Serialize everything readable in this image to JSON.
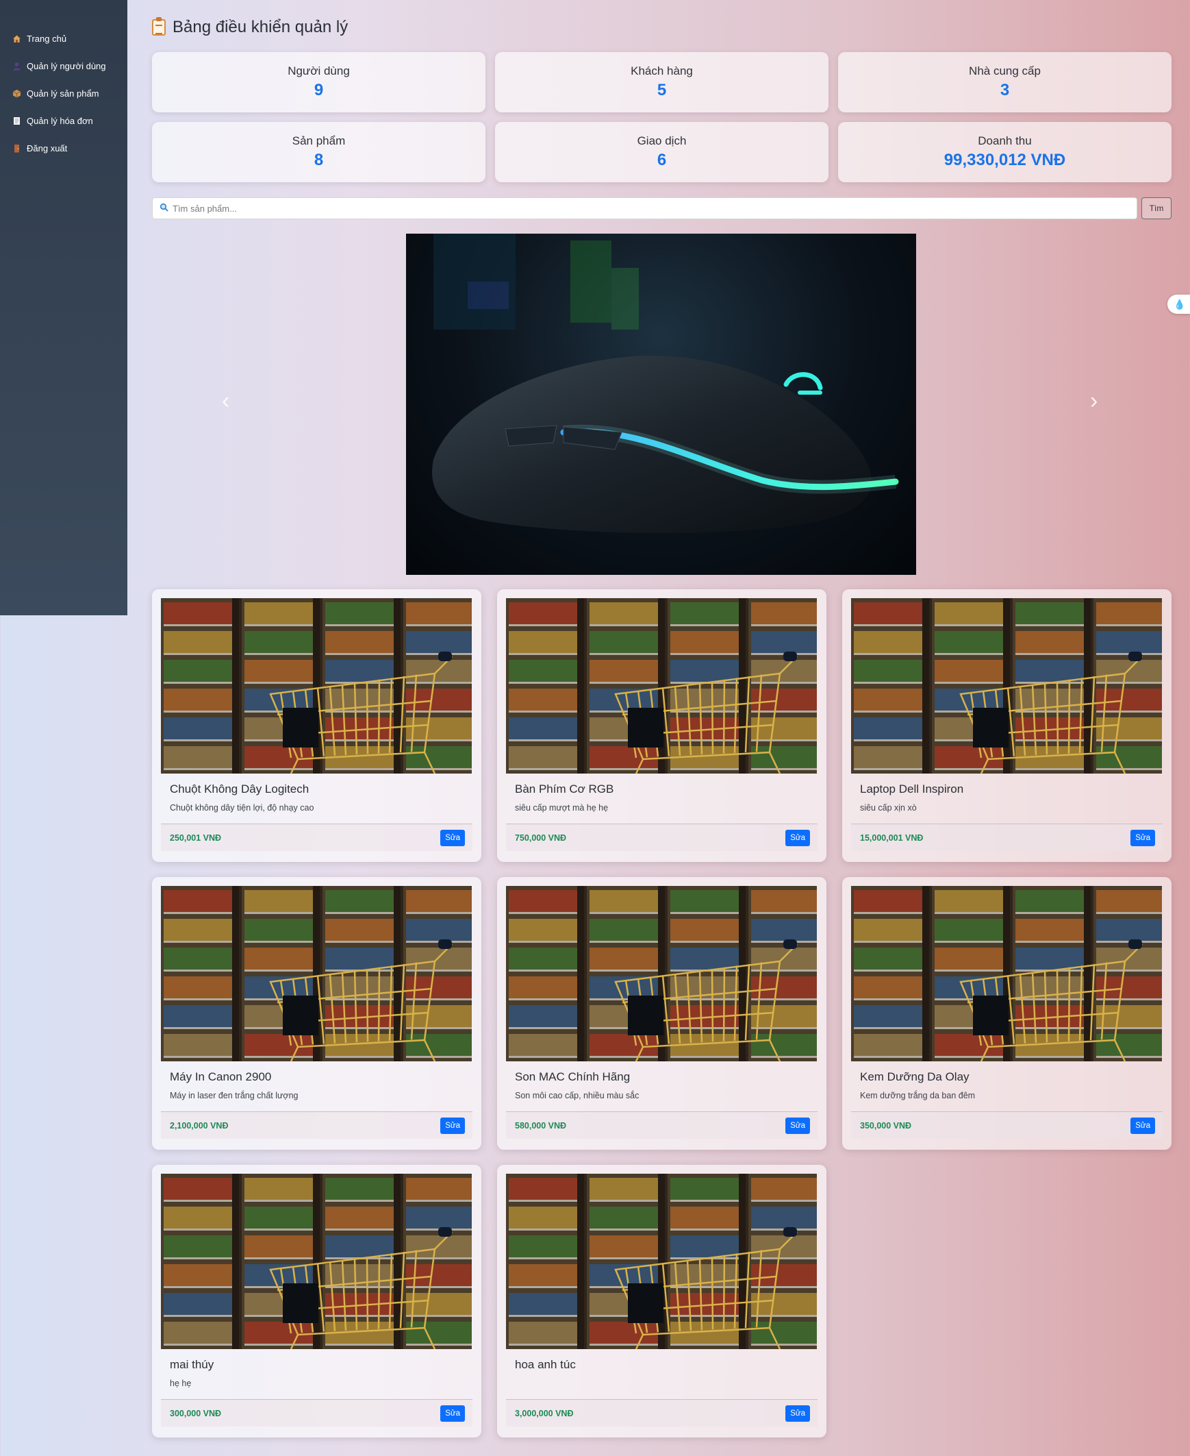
{
  "sidebar": {
    "items": [
      {
        "label": "Trang chủ",
        "icon": "house-icon"
      },
      {
        "label": "Quản lý người dùng",
        "icon": "user-icon"
      },
      {
        "label": "Quản lý sản phẩm",
        "icon": "box-icon"
      },
      {
        "label": "Quản lý hóa đơn",
        "icon": "receipt-icon"
      },
      {
        "label": "Đăng xuất",
        "icon": "door-icon"
      }
    ]
  },
  "header": {
    "title": "Bảng điều khiển quản lý",
    "icon": "clipboard-icon"
  },
  "stats": [
    {
      "label": "Người dùng",
      "value": "9"
    },
    {
      "label": "Khách hàng",
      "value": "5"
    },
    {
      "label": "Nhà cung cấp",
      "value": "3"
    },
    {
      "label": "Sản phẩm",
      "value": "8"
    },
    {
      "label": "Giao dịch",
      "value": "6"
    },
    {
      "label": "Doanh thu",
      "value": "99,330,012 VNĐ"
    }
  ],
  "search": {
    "placeholder": "Tìm sản phẩm...",
    "button_label": "Tìm",
    "icon": "search-icon"
  },
  "carousel": {
    "prev_icon": "chevron-left-icon",
    "next_icon": "chevron-right-icon",
    "image": "gaming-mouse-image"
  },
  "products": [
    {
      "name": "Chuột Không Dây Logitech",
      "desc": "Chuột không dây tiện lợi, độ nhạy cao",
      "price": "250,001 VNĐ",
      "edit_label": "Sửa"
    },
    {
      "name": "Bàn Phím Cơ RGB",
      "desc": "siêu cấp mượt mà hẹ hẹ",
      "price": "750,000 VNĐ",
      "edit_label": "Sửa"
    },
    {
      "name": "Laptop Dell Inspiron",
      "desc": "siêu cấp xịn xò",
      "price": "15,000,001 VNĐ",
      "edit_label": "Sửa"
    },
    {
      "name": "Máy In Canon 2900",
      "desc": "Máy in laser đen trắng chất lượng",
      "price": "2,100,000 VNĐ",
      "edit_label": "Sửa"
    },
    {
      "name": "Son MAC Chính Hãng",
      "desc": "Son môi cao cấp, nhiều màu sắc",
      "price": "580,000 VNĐ",
      "edit_label": "Sửa"
    },
    {
      "name": "Kem Dưỡng Da Olay",
      "desc": "Kem dưỡng trắng da ban đêm",
      "price": "350,000 VNĐ",
      "edit_label": "Sửa"
    },
    {
      "name": "mai thúy",
      "desc": "hẹ hẹ",
      "price": "300,000 VNĐ",
      "edit_label": "Sửa"
    },
    {
      "name": "hoa anh túc",
      "desc": "",
      "price": "3,000,000 VNĐ",
      "edit_label": "Sửa"
    }
  ],
  "colors": {
    "accent": "#1a73e8",
    "price": "#1c8a55",
    "button": "#0d6efd",
    "sidebar": "#334153"
  }
}
